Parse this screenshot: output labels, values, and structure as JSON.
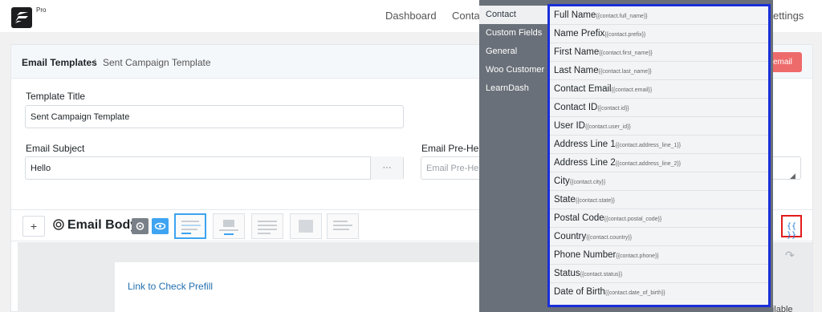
{
  "topnav": {
    "badge": "Pro",
    "links": [
      "Dashboard",
      "Contac",
      "ettings"
    ]
  },
  "breadcrumb": {
    "root": "Email Templates",
    "separator": "/",
    "current": "Sent Campaign Template"
  },
  "header": {
    "send_label": "email"
  },
  "form": {
    "title_label": "Template Title",
    "title_value": "Sent Campaign Template",
    "subject_label": "Email Subject",
    "subject_value": "Hello",
    "dots": "···",
    "preheader_label": "Email Pre-Hea",
    "preheader_placeholder": "Email Pre-He"
  },
  "email_body": {
    "plus": "+",
    "title": "Email Body",
    "smartcode_button": "{{ }}"
  },
  "canvas": {
    "link_text": "Link to Check Prefill",
    "hint": "- type  /  to see all the available blocks"
  },
  "smartcodes": {
    "categories": [
      {
        "label": "Contact",
        "active": true
      },
      {
        "label": "Custom Fields",
        "active": false
      },
      {
        "label": "General",
        "active": false
      },
      {
        "label": "Woo Customer",
        "active": false
      },
      {
        "label": "LearnDash",
        "active": false
      }
    ],
    "codes": [
      {
        "label": "Full Name",
        "tag": "{{contact.full_name}}"
      },
      {
        "label": "Name Prefix",
        "tag": "{{contact.prefix}}"
      },
      {
        "label": "First Name",
        "tag": "{{contact.first_name}}"
      },
      {
        "label": "Last Name",
        "tag": "{{contact.last_name}}"
      },
      {
        "label": "Contact Email",
        "tag": "{{contact.email}}"
      },
      {
        "label": "Contact ID",
        "tag": "{{contact.id}}"
      },
      {
        "label": "User ID",
        "tag": "{{contact.user_id}}"
      },
      {
        "label": "Address Line 1",
        "tag": "{{contact.address_line_1}}"
      },
      {
        "label": "Address Line 2",
        "tag": "{{contact.address_line_2}}"
      },
      {
        "label": "City",
        "tag": "{{contact.city}}"
      },
      {
        "label": "State",
        "tag": "{{contact.state}}"
      },
      {
        "label": "Postal Code",
        "tag": "{{contact.postal_code}}"
      },
      {
        "label": "Country",
        "tag": "{{contact.country}}"
      },
      {
        "label": "Phone Number",
        "tag": "{{contact.phone}}"
      },
      {
        "label": "Status",
        "tag": "{{contact.status}}"
      },
      {
        "label": "Date of Birth",
        "tag": "{{contact.date_of_birth}}"
      }
    ]
  },
  "colors": {
    "accent_blue": "#3ea3f1",
    "highlight_red": "#e21b1b",
    "popover_border": "#1a2fd8",
    "send_button": "#ee6b6b"
  }
}
